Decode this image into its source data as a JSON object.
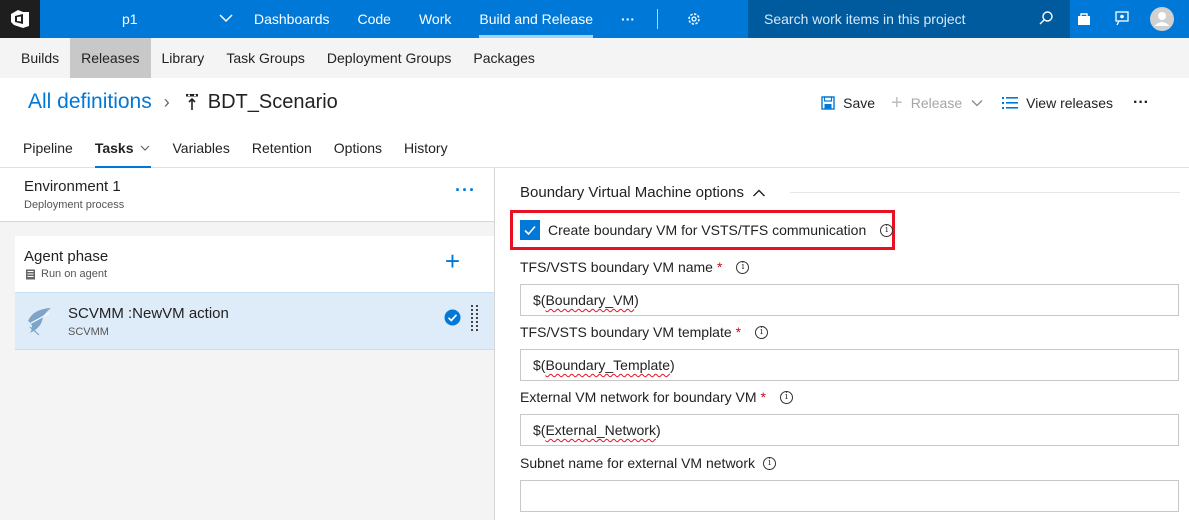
{
  "topbar": {
    "project": "p1",
    "nav": [
      "Dashboards",
      "Code",
      "Work",
      "Build and Release"
    ],
    "more": "···",
    "search_placeholder": "Search work items in this project"
  },
  "subnav": [
    "Builds",
    "Releases",
    "Library",
    "Task Groups",
    "Deployment Groups",
    "Packages"
  ],
  "header": {
    "breadcrumb_link": "All definitions",
    "definition_name": "BDT_Scenario",
    "save": "Save",
    "release": "Release",
    "view_releases": "View releases",
    "more": "···"
  },
  "tabs": [
    "Pipeline",
    "Tasks",
    "Variables",
    "Retention",
    "Options",
    "History"
  ],
  "left": {
    "environment_title": "Environment 1",
    "environment_sub": "Deployment process",
    "environment_more": "···",
    "phase_title": "Agent phase",
    "phase_sub": "Run on agent",
    "task_title": "SCVMM :NewVM action",
    "task_sub": "SCVMM"
  },
  "right": {
    "section_title": "Boundary Virtual Machine options",
    "checkbox_label": "Create boundary VM for VSTS/TFS communication",
    "fields": [
      {
        "label": "TFS/VSTS boundary VM name",
        "required": "*",
        "value_prefix": "$(",
        "value_word": "Boundary_VM",
        "value_suffix": ")"
      },
      {
        "label": "TFS/VSTS boundary VM template",
        "required": "*",
        "value_prefix": "$(",
        "value_word": "Boundary_Template",
        "value_suffix": ")"
      },
      {
        "label": "External VM network for boundary VM",
        "required": "*",
        "value_prefix": "$(",
        "value_word": "External_Network",
        "value_suffix": ")"
      },
      {
        "label": "Subnet name for external VM network",
        "required": "",
        "value_prefix": "",
        "value_word": "",
        "value_suffix": ""
      }
    ]
  },
  "colors": {
    "accent": "#0078d7",
    "highlight": "#e81123",
    "selected_row": "#deecf9"
  }
}
